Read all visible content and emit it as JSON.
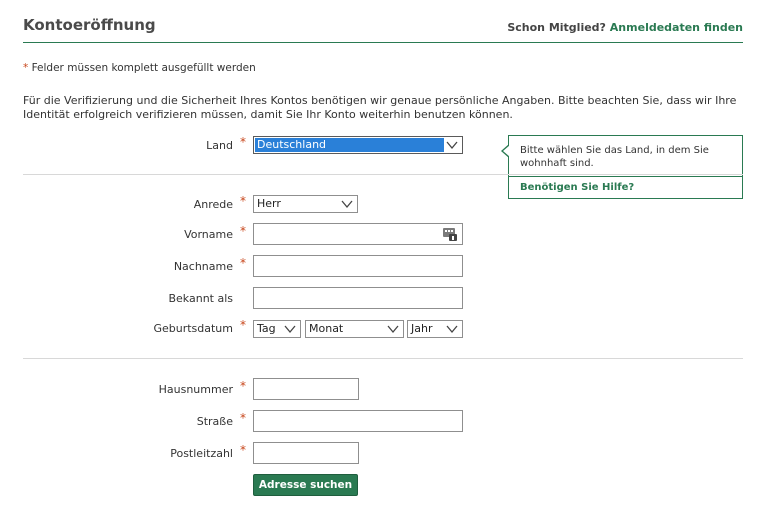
{
  "header": {
    "title": "Kontoeröffnung",
    "member_prefix": "Schon Mitglied?",
    "member_link": "Anmeldedaten finden"
  },
  "required_note": {
    "star": "*",
    "text": "Felder müssen komplett ausgefüllt werden"
  },
  "intro": "Für die Verifizierung und die Sicherheit Ihres Kontos benötigen wir genaue persönliche Angaben. Bitte beachten Sie, dass wir Ihre Identität erfolgreich verifizieren müssen, damit Sie Ihr Konto weiterhin benutzen können.",
  "country": {
    "label": "Land",
    "value": "Deutschland"
  },
  "tooltip": {
    "text": "Bitte wählen Sie das Land, in dem Sie wohnhaft sind.",
    "help": "Benötigen Sie Hilfe?"
  },
  "personal": {
    "salutation": {
      "label": "Anrede",
      "value": "Herr"
    },
    "first_name": {
      "label": "Vorname",
      "value": ""
    },
    "last_name": {
      "label": "Nachname",
      "value": ""
    },
    "known_as": {
      "label": "Bekannt als",
      "value": ""
    },
    "birthdate": {
      "label": "Geburtsdatum",
      "day": "Tag",
      "month": "Monat",
      "year": "Jahr"
    }
  },
  "address": {
    "house_number": {
      "label": "Hausnummer",
      "value": ""
    },
    "street": {
      "label": "Straße",
      "value": ""
    },
    "postcode": {
      "label": "Postleitzahl",
      "value": ""
    },
    "search_button": "Adresse suchen"
  },
  "required_star": "*",
  "colors": {
    "accent": "#2a7a52",
    "required": "#c8461b",
    "selection": "#2a80d8"
  }
}
